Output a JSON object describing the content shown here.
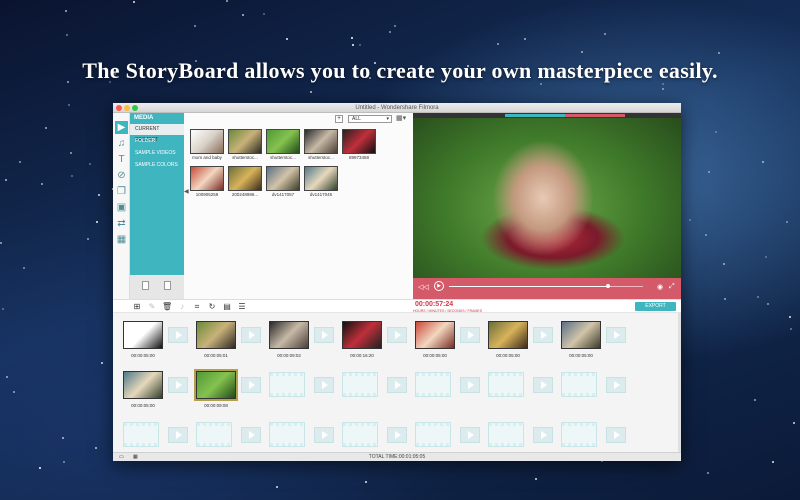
{
  "headline": "The StoryBoard allows you to create your own masterpiece easily.",
  "window": {
    "title": "Untitled - Wondershare Filmora",
    "traffic_colors": [
      "#fc5753",
      "#fdbc40",
      "#33c748"
    ]
  },
  "rail": {
    "items": [
      {
        "icon": "media-icon",
        "glyph": "▶",
        "active": true
      },
      {
        "icon": "music-icon",
        "glyph": "♫",
        "active": false
      },
      {
        "icon": "text-icon",
        "glyph": "T",
        "active": false
      },
      {
        "icon": "filter-icon",
        "glyph": "⊘",
        "active": false
      },
      {
        "icon": "overlay-icon",
        "glyph": "❐",
        "active": false
      },
      {
        "icon": "element-icon",
        "glyph": "▣",
        "active": false
      },
      {
        "icon": "transition-icon",
        "glyph": "⇄",
        "active": false
      },
      {
        "icon": "split-screen-icon",
        "glyph": "▦",
        "active": false
      }
    ]
  },
  "media": {
    "header": "MEDIA",
    "categories": [
      {
        "label": "CURRENT PROJECT",
        "active": true
      },
      {
        "label": "FOLDER",
        "active": false
      },
      {
        "label": "SAMPLE VIDEOS",
        "active": false
      },
      {
        "label": "SAMPLE COLORS",
        "active": false
      }
    ],
    "filter": "ALL",
    "add_label": "+",
    "view_glyph": "▦▾",
    "items": [
      {
        "label": "mom and baby",
        "colors": [
          "#ffffff",
          "#d9d2c8",
          "#8a6c5a"
        ]
      },
      {
        "label": "shutterstoc...",
        "colors": [
          "#6a8a3a",
          "#c9b27a",
          "#2d2a22"
        ]
      },
      {
        "label": "shutterstoc...",
        "colors": [
          "#4f9a36",
          "#86c24f",
          "#1f4a18"
        ]
      },
      {
        "label": "shutterstoc...",
        "colors": [
          "#2a2a2a",
          "#c7b9a6",
          "#4a3f36"
        ]
      },
      {
        "label": "89973458",
        "colors": [
          "#2a1f1f",
          "#c02f3a",
          "#111111"
        ]
      },
      {
        "label": "100905259",
        "colors": [
          "#c94a3a",
          "#f2d7c0",
          "#7a2a22"
        ]
      },
      {
        "label": "200248986...",
        "colors": [
          "#6b6f3a",
          "#d9b35a",
          "#3a2a1a"
        ]
      },
      {
        "label": "dv1417057",
        "colors": [
          "#5a6f8a",
          "#d2c4a8",
          "#3a3a2a"
        ]
      },
      {
        "label": "dv1417045",
        "colors": [
          "#4f7a8a",
          "#e7d8bc",
          "#2f3f2a"
        ]
      }
    ]
  },
  "player": {
    "top_segments": [
      "#3fb5c0",
      "#d45a69"
    ],
    "controls_color": "#d45a69",
    "progress": 0.82,
    "prev_glyph": "◁◁",
    "play_glyph": "▶",
    "snapshot_glyph": "◉",
    "fullscreen_glyph": "⤢"
  },
  "toolbar": {
    "tools": [
      {
        "name": "add-media-tool-icon",
        "glyph": "⊞",
        "dim": false
      },
      {
        "name": "edit-tool-icon",
        "glyph": "✎",
        "dim": true
      },
      {
        "name": "delete-tool-icon",
        "glyph": "🗑",
        "dim": false
      },
      {
        "name": "audio-tool-icon",
        "glyph": "♪",
        "dim": true
      },
      {
        "name": "crop-tool-icon",
        "glyph": "⌗",
        "dim": false
      },
      {
        "name": "rotate-tool-icon",
        "glyph": "↻",
        "dim": false
      },
      {
        "name": "record-tool-icon",
        "glyph": "▤",
        "dim": false
      },
      {
        "name": "adjust-tool-icon",
        "glyph": "☰",
        "dim": false
      }
    ],
    "timecode": "00:00:57:24",
    "timecode_units": "HOURS / MINUTES / SECONDS / FRAMES",
    "export_label": "EXPORT"
  },
  "storyboard": {
    "clips": [
      {
        "time": "00:00:05:00",
        "colors": [
          "#ffffff",
          "#ffffff",
          "#111111"
        ],
        "selected": false
      },
      {
        "time": "00:00:05:01",
        "colors": [
          "#6a8a3a",
          "#c9b27a",
          "#2d2a22"
        ],
        "selected": false
      },
      {
        "time": "00:00:09:02",
        "colors": [
          "#2a2a2a",
          "#c7b9a6",
          "#4a3f36"
        ],
        "selected": false
      },
      {
        "time": "00:00:16:20",
        "colors": [
          "#111111",
          "#c02f3a",
          "#222222"
        ],
        "selected": false
      },
      {
        "time": "00:00:05:00",
        "colors": [
          "#c94a3a",
          "#f2d7c0",
          "#7a2a22"
        ],
        "selected": false
      },
      {
        "time": "00:00:05:00",
        "colors": [
          "#6b6f3a",
          "#d9b35a",
          "#3a2a1a"
        ],
        "selected": false
      },
      {
        "time": "00:00:05:00",
        "colors": [
          "#5a6f8a",
          "#d2c4a8",
          "#3a3a2a"
        ],
        "selected": false
      },
      {
        "time": "00:00:05:00",
        "colors": [
          "#4f7a8a",
          "#e7d8bc",
          "#2f3f2a"
        ],
        "selected": false
      },
      {
        "time": "00:00:09:08",
        "colors": [
          "#4f9a36",
          "#86c24f",
          "#1f4a18"
        ],
        "selected": true
      }
    ],
    "empty_slots_row2": 7,
    "empty_slots_row3": 7,
    "total_time": "TOTAL TIME:00:01:05:05"
  }
}
